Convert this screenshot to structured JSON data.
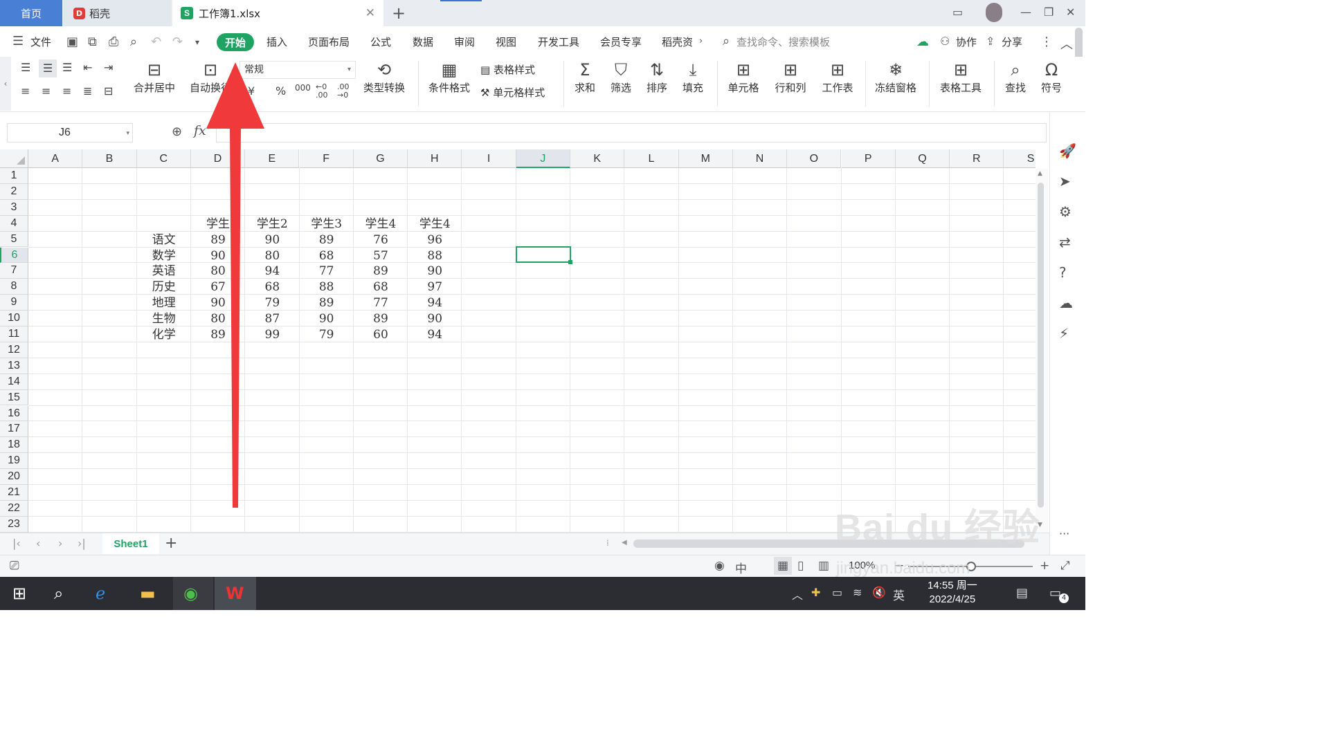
{
  "title_tabs": {
    "home": "首页",
    "daoke": "稻壳",
    "workbook": "工作簿1.xlsx",
    "s_logo": "S",
    "d_logo": "D"
  },
  "menu": {
    "file": "文件",
    "items": [
      "开始",
      "插入",
      "页面布局",
      "公式",
      "数据",
      "审阅",
      "视图",
      "开发工具",
      "会员专享",
      "稻壳资"
    ],
    "search_placeholder": "查找命令、搜索模板",
    "collab": "协作",
    "share": "分享"
  },
  "ribbon": {
    "merge_center": "合并居中",
    "auto_wrap": "自动换行",
    "number_format": "常规",
    "type_convert": "类型转换",
    "conditional_format": "条件格式",
    "table_style": "表格样式",
    "cell_style": "单元格样式",
    "sum": "求和",
    "filter": "筛选",
    "sort": "排序",
    "fill": "填充",
    "cell": "单元格",
    "row_col": "行和列",
    "worksheet": "工作表",
    "freeze": "冻结窗格",
    "table_tools": "表格工具",
    "find": "查找",
    "symbol": "符号",
    "currency": "¥",
    "percent": "%",
    "thousands": "000",
    "dec_inc": "←0 .00",
    "dec_dec": ".00 →0"
  },
  "formula_bar": {
    "name_box": "J6",
    "fx": "fx",
    "formula": ""
  },
  "columns": [
    "A",
    "B",
    "C",
    "D",
    "E",
    "F",
    "G",
    "H",
    "I",
    "J",
    "K",
    "L",
    "M",
    "N",
    "O",
    "P",
    "Q",
    "R",
    "S"
  ],
  "active_column": "J",
  "rows": [
    "1",
    "2",
    "3",
    "4",
    "5",
    "6",
    "7",
    "8",
    "9",
    "10",
    "11",
    "12",
    "13",
    "14",
    "15",
    "16",
    "17",
    "18",
    "19",
    "20",
    "21",
    "22",
    "23"
  ],
  "active_row": "6",
  "table": {
    "headers": [
      "学生",
      "学生2",
      "学生3",
      "学生4",
      "学生4"
    ],
    "subjects": [
      "语文",
      "数学",
      "英语",
      "历史",
      "地理",
      "生物",
      "化学"
    ],
    "values": [
      [
        89,
        90,
        89,
        76,
        96
      ],
      [
        90,
        80,
        68,
        57,
        88
      ],
      [
        80,
        94,
        77,
        89,
        90
      ],
      [
        67,
        68,
        88,
        68,
        97
      ],
      [
        90,
        79,
        89,
        77,
        94
      ],
      [
        80,
        87,
        90,
        89,
        90
      ],
      [
        89,
        99,
        79,
        60,
        94
      ]
    ]
  },
  "sheets": {
    "active": "Sheet1"
  },
  "status": {
    "zoom": "100%"
  },
  "taskbar": {
    "time": "14:55 周一",
    "date": "2022/4/25",
    "ime": "英",
    "notif_count": "4"
  },
  "watermark": {
    "main": "Bai du 经验",
    "sub": "jingyan.baidu.com"
  },
  "colors": {
    "accent": "#1ea362",
    "arrow": "#f0393b",
    "tab_home": "#4a7fd6"
  }
}
